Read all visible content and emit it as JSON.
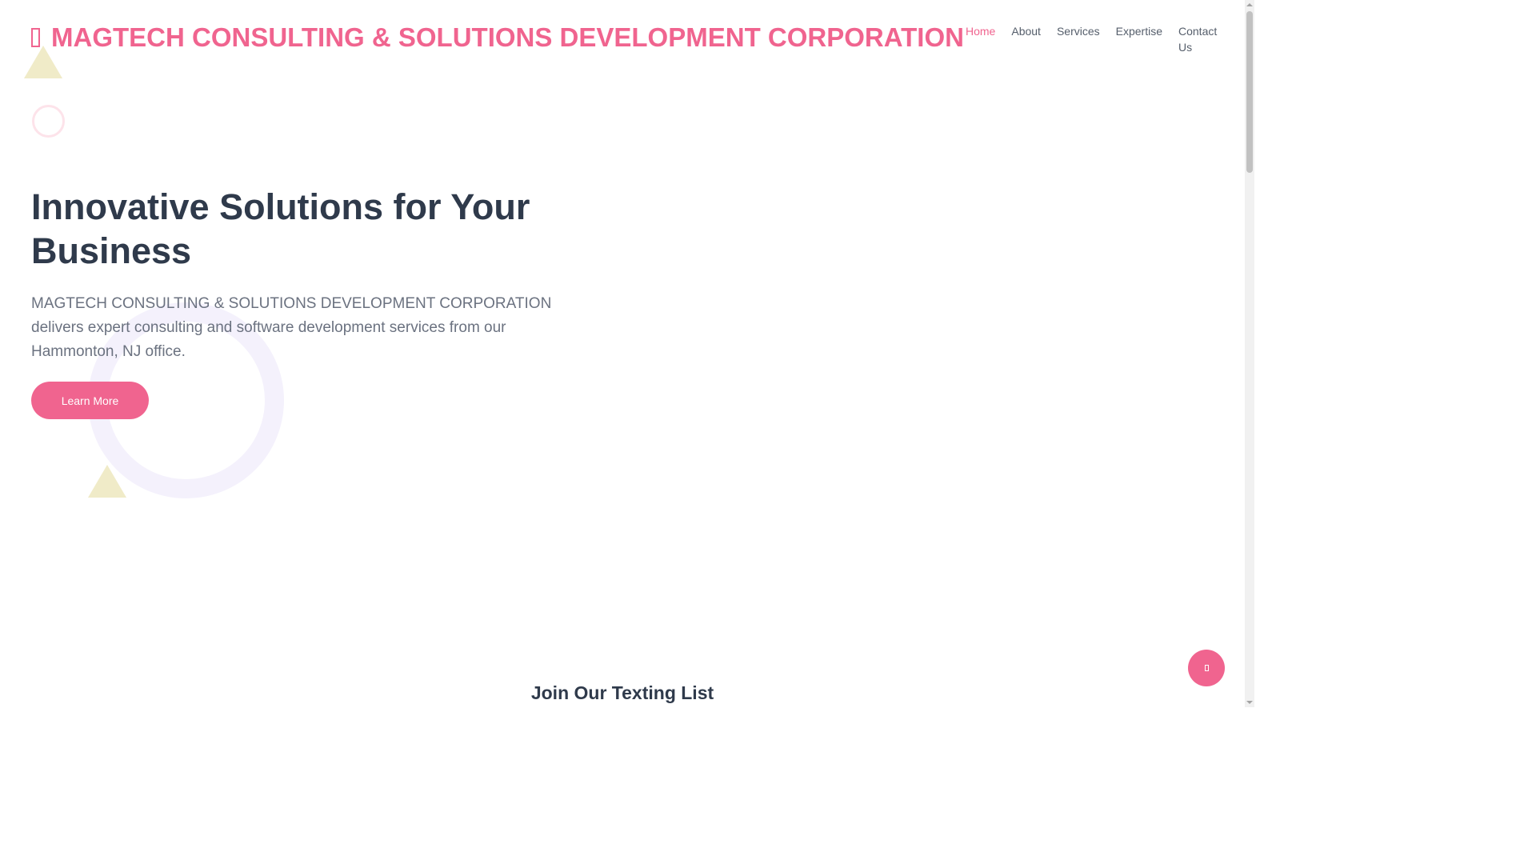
{
  "header": {
    "logo_text": "MAGTECH CONSULTING & SOLUTIONS DEVELOPMENT CORPORATION",
    "logo_icon": "square-icon"
  },
  "nav": {
    "items": [
      {
        "label": "Home",
        "active": true
      },
      {
        "label": "About",
        "active": false
      },
      {
        "label": "Services",
        "active": false
      },
      {
        "label": "Expertise",
        "active": false
      },
      {
        "label": "Contact Us",
        "active": false
      }
    ]
  },
  "hero": {
    "title": "Innovative Solutions for Your Business",
    "description": "MAGTECH CONSULTING & SOLUTIONS DEVELOPMENT CORPORATION delivers expert consulting and software development services from our Hammonton, NJ office.",
    "button_label": "Learn More"
  },
  "texting": {
    "title": "Join Our Texting List"
  },
  "floating_button": {
    "icon": "chat-icon"
  },
  "colors": {
    "accent": "#f0648f",
    "heading": "#2f3a4b",
    "body_text": "#6b7280",
    "triangle": "#f0ebc8",
    "ring_light_pink": "#fde3ea",
    "ring_lavender": "#f4f1fc"
  }
}
